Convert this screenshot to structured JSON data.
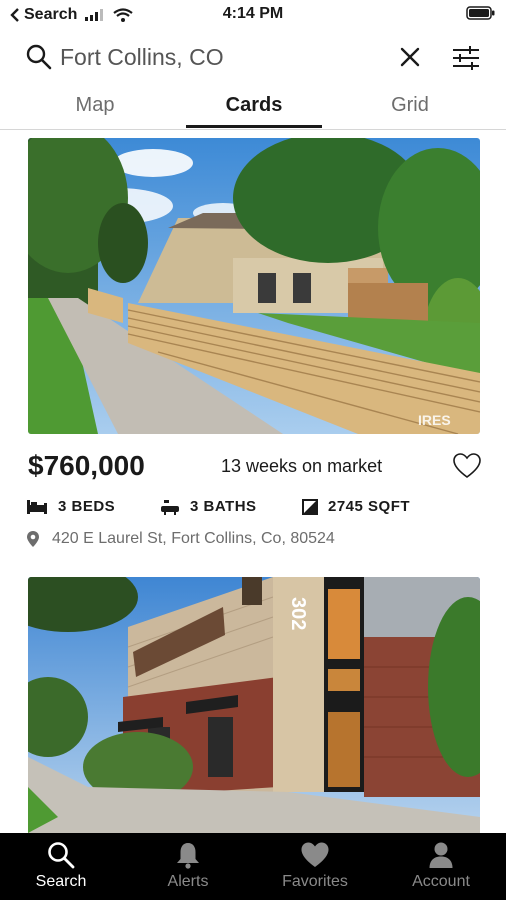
{
  "status_bar": {
    "back_app": "Search",
    "time": "4:14 PM"
  },
  "search": {
    "query": "Fort Collins, CO"
  },
  "tabs": [
    {
      "label": "Map",
      "active": false
    },
    {
      "label": "Cards",
      "active": true
    },
    {
      "label": "Grid",
      "active": false
    }
  ],
  "listings": [
    {
      "price": "$760,000",
      "days_on_market": "13 weeks on market",
      "beds": "3 BEDS",
      "baths": "3 BATHS",
      "sqft": "2745 SQFT",
      "address": "420 E Laurel St, Fort Collins, Co, 80524",
      "watermark": "IRES"
    },
    {
      "building_number": "302"
    }
  ],
  "bottom_nav": [
    {
      "label": "Search",
      "icon": "search-icon",
      "active": true
    },
    {
      "label": "Alerts",
      "icon": "bell-icon",
      "active": false
    },
    {
      "label": "Favorites",
      "icon": "heart-icon",
      "active": false
    },
    {
      "label": "Account",
      "icon": "person-icon",
      "active": false
    }
  ],
  "colors": {
    "active_text": "#1a1a1a",
    "inactive_text": "#6d6d6d",
    "nav_background": "#000000"
  }
}
